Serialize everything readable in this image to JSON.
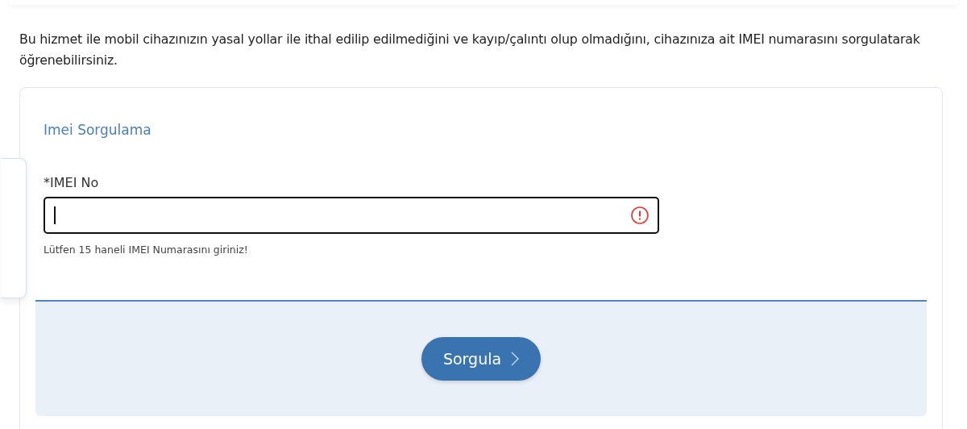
{
  "intro": "Bu hizmet ile mobil cihazınızın yasal yollar ile ithal edilip edilmediğini ve kayıp/çalıntı olup olmadığını, cihazınıza ait IMEI numarasını sorgulatarak öğrenebilirsiniz.",
  "form": {
    "title": "Imei Sorgulama",
    "field": {
      "label": "*IMEI No",
      "error": true,
      "focused": true,
      "hint": "Lütfen 15 haneli IMEI Numarasını giriniz!"
    }
  },
  "button": {
    "label": "Sorgula"
  }
}
